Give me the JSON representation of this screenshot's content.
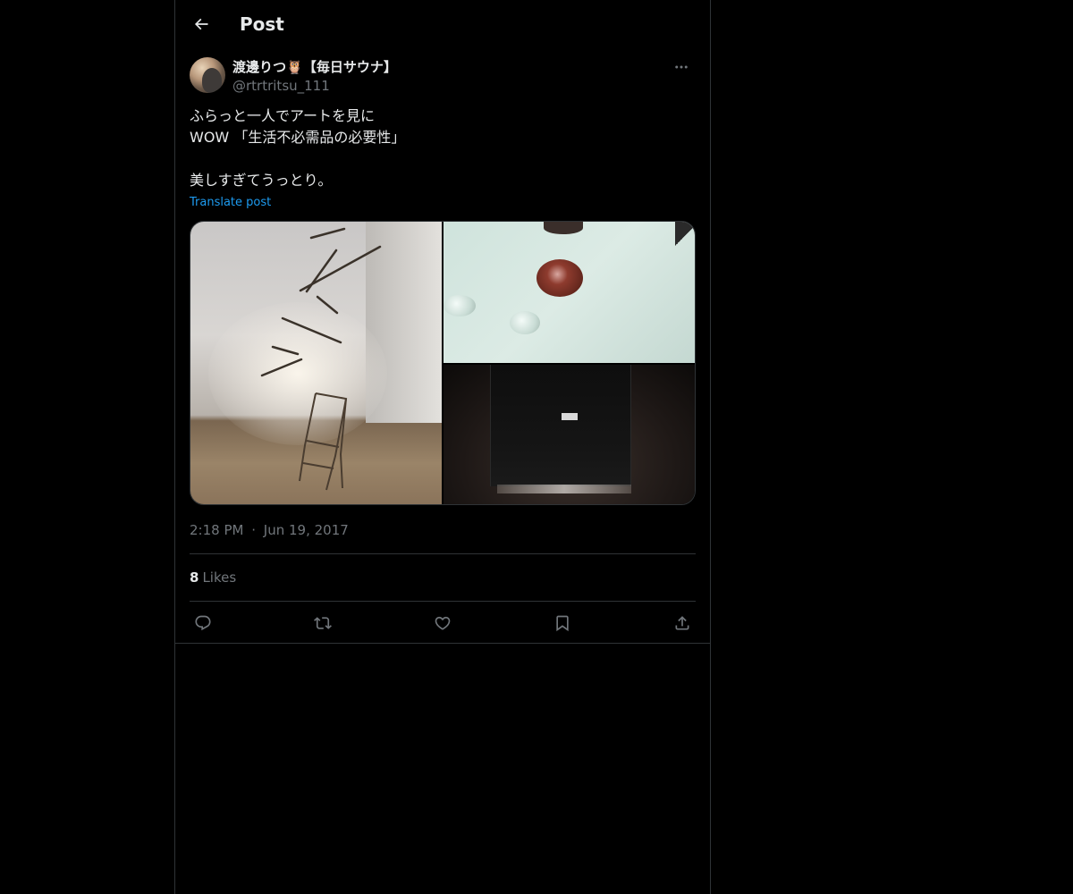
{
  "header": {
    "title": "Post"
  },
  "post": {
    "author": {
      "name": "渡邊りつ🦉【毎日サウナ】",
      "handle": "@rtrtritsu_111"
    },
    "text": "ふらっと一人でアートを見に\nWOW 「生活不必需品の必要性」\n\n美しすぎてうっとり。",
    "translate_label": "Translate post",
    "time": "2:18 PM",
    "date_separator": "·",
    "date": "Jun 19, 2017",
    "likes": {
      "count": "8",
      "label": "Likes"
    }
  },
  "actions": [
    {
      "icon": "reply-icon"
    },
    {
      "icon": "repost-icon"
    },
    {
      "icon": "like-icon"
    },
    {
      "icon": "bookmark-icon"
    },
    {
      "icon": "share-icon"
    }
  ],
  "colors": {
    "background": "#000000",
    "text": "#e7e9ea",
    "secondary_text": "#71767b",
    "link": "#1d9bf0",
    "border": "#2f3336"
  }
}
